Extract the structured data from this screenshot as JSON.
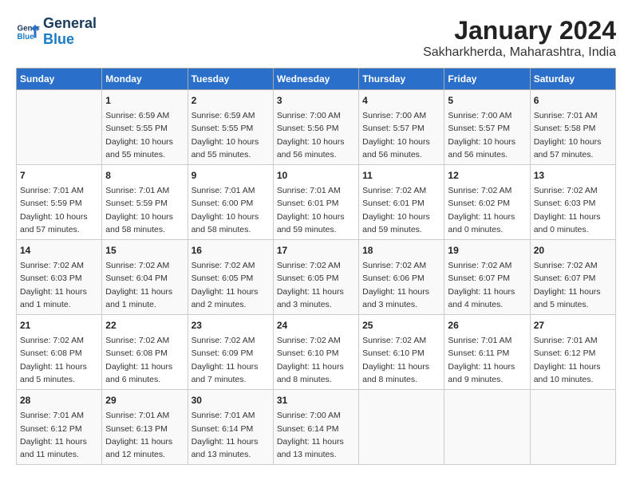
{
  "logo": {
    "line1": "General",
    "line2": "Blue"
  },
  "title": "January 2024",
  "subtitle": "Sakharkherda, Maharashtra, India",
  "days_of_week": [
    "Sunday",
    "Monday",
    "Tuesday",
    "Wednesday",
    "Thursday",
    "Friday",
    "Saturday"
  ],
  "weeks": [
    [
      {
        "day": "",
        "info": ""
      },
      {
        "day": "1",
        "info": "Sunrise: 6:59 AM\nSunset: 5:55 PM\nDaylight: 10 hours\nand 55 minutes."
      },
      {
        "day": "2",
        "info": "Sunrise: 6:59 AM\nSunset: 5:55 PM\nDaylight: 10 hours\nand 55 minutes."
      },
      {
        "day": "3",
        "info": "Sunrise: 7:00 AM\nSunset: 5:56 PM\nDaylight: 10 hours\nand 56 minutes."
      },
      {
        "day": "4",
        "info": "Sunrise: 7:00 AM\nSunset: 5:57 PM\nDaylight: 10 hours\nand 56 minutes."
      },
      {
        "day": "5",
        "info": "Sunrise: 7:00 AM\nSunset: 5:57 PM\nDaylight: 10 hours\nand 56 minutes."
      },
      {
        "day": "6",
        "info": "Sunrise: 7:01 AM\nSunset: 5:58 PM\nDaylight: 10 hours\nand 57 minutes."
      }
    ],
    [
      {
        "day": "7",
        "info": "Sunrise: 7:01 AM\nSunset: 5:59 PM\nDaylight: 10 hours\nand 57 minutes."
      },
      {
        "day": "8",
        "info": "Sunrise: 7:01 AM\nSunset: 5:59 PM\nDaylight: 10 hours\nand 58 minutes."
      },
      {
        "day": "9",
        "info": "Sunrise: 7:01 AM\nSunset: 6:00 PM\nDaylight: 10 hours\nand 58 minutes."
      },
      {
        "day": "10",
        "info": "Sunrise: 7:01 AM\nSunset: 6:01 PM\nDaylight: 10 hours\nand 59 minutes."
      },
      {
        "day": "11",
        "info": "Sunrise: 7:02 AM\nSunset: 6:01 PM\nDaylight: 10 hours\nand 59 minutes."
      },
      {
        "day": "12",
        "info": "Sunrise: 7:02 AM\nSunset: 6:02 PM\nDaylight: 11 hours\nand 0 minutes."
      },
      {
        "day": "13",
        "info": "Sunrise: 7:02 AM\nSunset: 6:03 PM\nDaylight: 11 hours\nand 0 minutes."
      }
    ],
    [
      {
        "day": "14",
        "info": "Sunrise: 7:02 AM\nSunset: 6:03 PM\nDaylight: 11 hours\nand 1 minute."
      },
      {
        "day": "15",
        "info": "Sunrise: 7:02 AM\nSunset: 6:04 PM\nDaylight: 11 hours\nand 1 minute."
      },
      {
        "day": "16",
        "info": "Sunrise: 7:02 AM\nSunset: 6:05 PM\nDaylight: 11 hours\nand 2 minutes."
      },
      {
        "day": "17",
        "info": "Sunrise: 7:02 AM\nSunset: 6:05 PM\nDaylight: 11 hours\nand 3 minutes."
      },
      {
        "day": "18",
        "info": "Sunrise: 7:02 AM\nSunset: 6:06 PM\nDaylight: 11 hours\nand 3 minutes."
      },
      {
        "day": "19",
        "info": "Sunrise: 7:02 AM\nSunset: 6:07 PM\nDaylight: 11 hours\nand 4 minutes."
      },
      {
        "day": "20",
        "info": "Sunrise: 7:02 AM\nSunset: 6:07 PM\nDaylight: 11 hours\nand 5 minutes."
      }
    ],
    [
      {
        "day": "21",
        "info": "Sunrise: 7:02 AM\nSunset: 6:08 PM\nDaylight: 11 hours\nand 5 minutes."
      },
      {
        "day": "22",
        "info": "Sunrise: 7:02 AM\nSunset: 6:08 PM\nDaylight: 11 hours\nand 6 minutes."
      },
      {
        "day": "23",
        "info": "Sunrise: 7:02 AM\nSunset: 6:09 PM\nDaylight: 11 hours\nand 7 minutes."
      },
      {
        "day": "24",
        "info": "Sunrise: 7:02 AM\nSunset: 6:10 PM\nDaylight: 11 hours\nand 8 minutes."
      },
      {
        "day": "25",
        "info": "Sunrise: 7:02 AM\nSunset: 6:10 PM\nDaylight: 11 hours\nand 8 minutes."
      },
      {
        "day": "26",
        "info": "Sunrise: 7:01 AM\nSunset: 6:11 PM\nDaylight: 11 hours\nand 9 minutes."
      },
      {
        "day": "27",
        "info": "Sunrise: 7:01 AM\nSunset: 6:12 PM\nDaylight: 11 hours\nand 10 minutes."
      }
    ],
    [
      {
        "day": "28",
        "info": "Sunrise: 7:01 AM\nSunset: 6:12 PM\nDaylight: 11 hours\nand 11 minutes."
      },
      {
        "day": "29",
        "info": "Sunrise: 7:01 AM\nSunset: 6:13 PM\nDaylight: 11 hours\nand 12 minutes."
      },
      {
        "day": "30",
        "info": "Sunrise: 7:01 AM\nSunset: 6:14 PM\nDaylight: 11 hours\nand 13 minutes."
      },
      {
        "day": "31",
        "info": "Sunrise: 7:00 AM\nSunset: 6:14 PM\nDaylight: 11 hours\nand 13 minutes."
      },
      {
        "day": "",
        "info": ""
      },
      {
        "day": "",
        "info": ""
      },
      {
        "day": "",
        "info": ""
      }
    ]
  ]
}
